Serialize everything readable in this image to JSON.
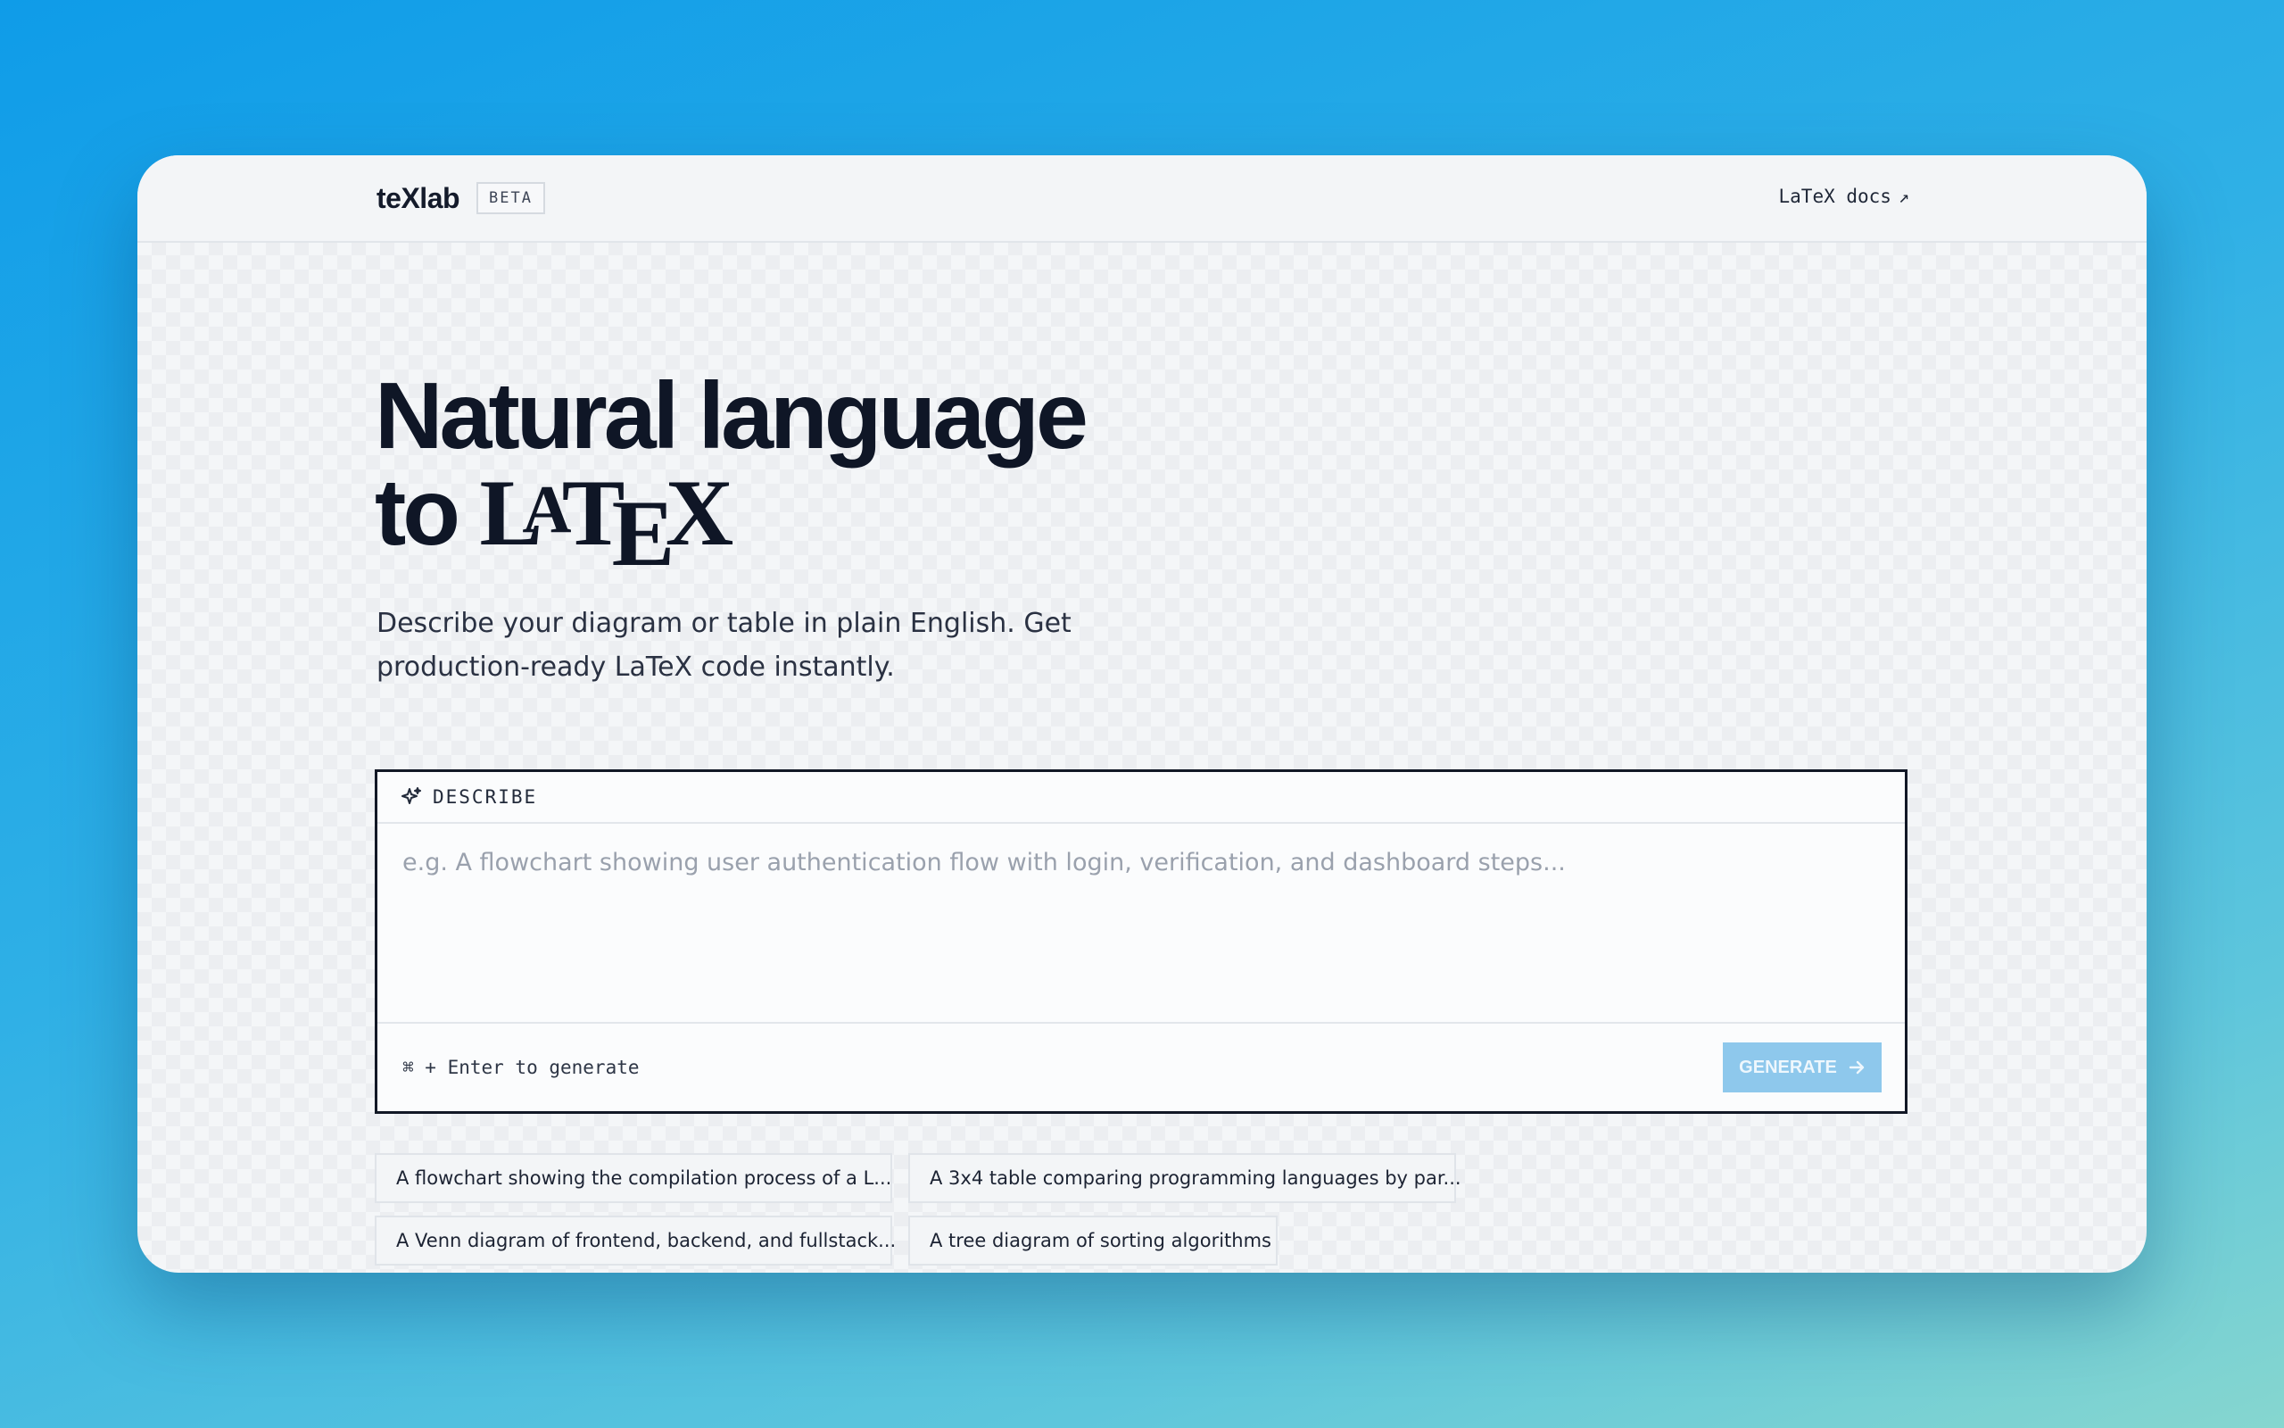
{
  "header": {
    "logo": "teXlab",
    "badge": "BETA",
    "docs_link": "LaTeX docs",
    "docs_icon": "external-arrow-icon"
  },
  "hero": {
    "title_line1": "Natural language",
    "title_line2_prefix": "to",
    "latex_logo": {
      "l": "L",
      "a": "A",
      "t": "T",
      "e": "E",
      "x": "X"
    },
    "subtitle": "Describe your diagram or table in plain English. Get production-ready LaTeX code instantly."
  },
  "prompt": {
    "label": "DESCRIBE",
    "label_icon": "sparkle-icon",
    "placeholder": "e.g. A flowchart showing user authentication flow with login, verification, and dashboard steps...",
    "value": "",
    "shortcut_hint": "⌘ + Enter to generate",
    "generate_label": "GENERATE",
    "generate_icon": "arrow-right-icon"
  },
  "examples": [
    "A flowchart showing the compilation process of a L...",
    "A 3x4 table comparing programming languages by par...",
    "A Venn diagram of frontend, backend, and fullstack...",
    "A tree diagram of sorting algorithms"
  ],
  "colors": {
    "accent": "#8ec8ec",
    "text_dark": "#0f1626",
    "border_dark": "#121826"
  }
}
